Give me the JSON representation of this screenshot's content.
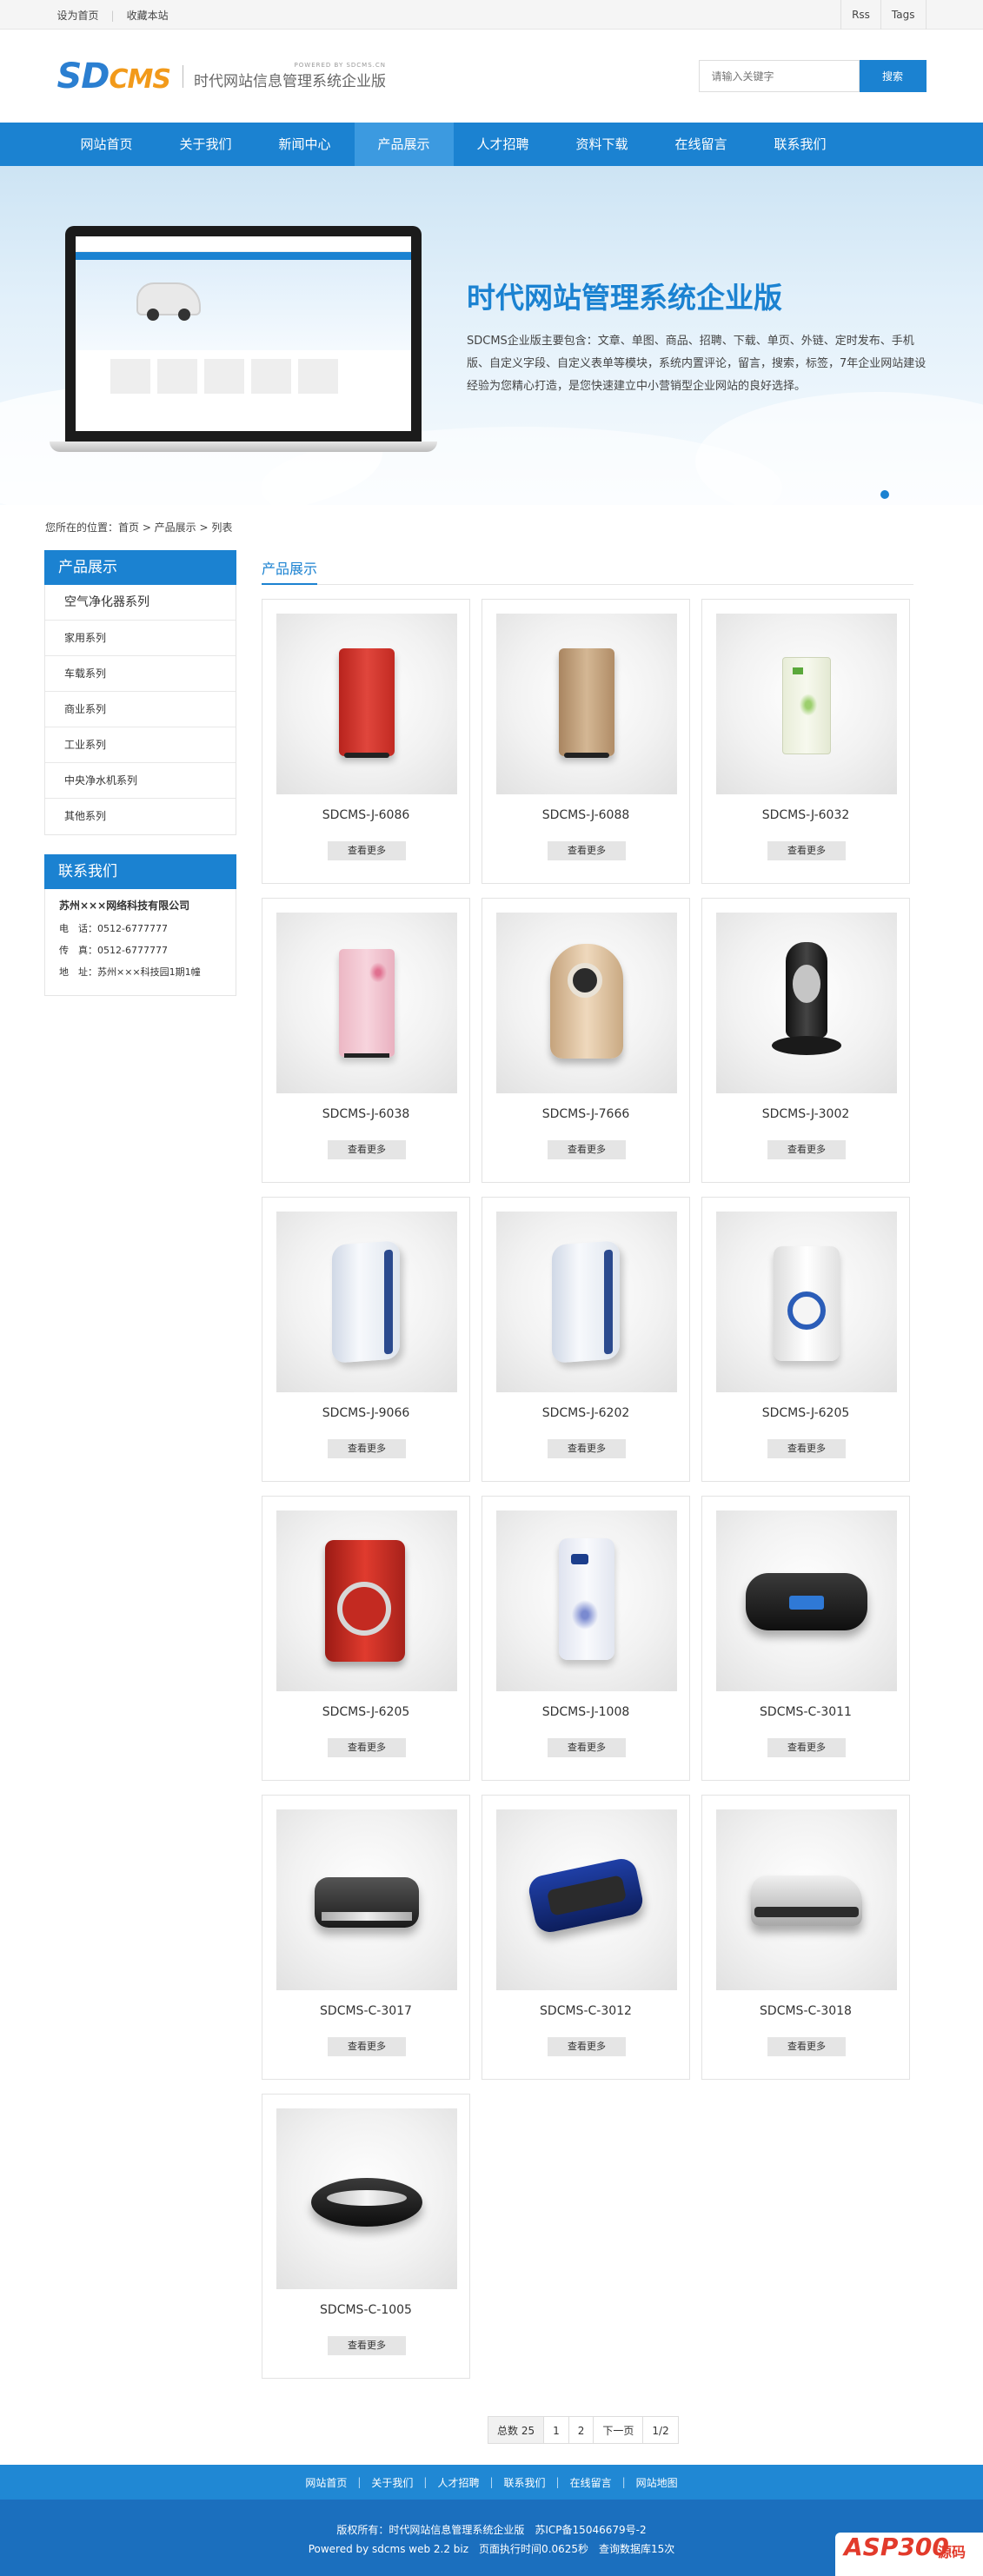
{
  "topbar": {
    "set_home": "设为首页",
    "bookmark": "收藏本站",
    "rss": "Rss",
    "tags": "Tags"
  },
  "header": {
    "logo_sd": "SD",
    "logo_cms": "CMS",
    "tagline": "时代网站信息管理系统企业版",
    "tagline_en": "POWERED BY SDCMS.CN",
    "search_placeholder": "请输入关键字",
    "search_button": "搜索"
  },
  "nav": [
    "网站首页",
    "关于我们",
    "新闻中心",
    "产品展示",
    "人才招聘",
    "资料下载",
    "在线留言",
    "联系我们"
  ],
  "nav_active_index": 3,
  "banner": {
    "title": "时代网站管理系统企业版",
    "desc": "SDCMS企业版主要包含：文章、单图、商品、招聘、下载、单页、外链、定时发布、手机版、自定义字段、自定义表单等模块，系统内置评论，留言，搜索，标签，7年企业网站建设经验为您精心打造，是您快速建立中小营销型企业网站的良好选择。"
  },
  "breadcrumb": "您所在的位置：首页 > 产品展示 > 列表",
  "sidebar": {
    "title": "产品展示",
    "items": [
      "空气净化器系列",
      "家用系列",
      "车载系列",
      "商业系列",
      "工业系列",
      "中央净水机系列",
      "其他系列"
    ],
    "contact_title": "联系我们",
    "company": "苏州×××网络科技有限公司",
    "phone": "电　话：0512-6777777",
    "fax": "传　真：0512-6777777",
    "address": "地　址：苏州×××科技园1期1幢"
  },
  "main": {
    "title": "产品展示",
    "more_label": "查看更多",
    "products": [
      {
        "name": "SDCMS-J-6086",
        "type": "tower-red"
      },
      {
        "name": "SDCMS-J-6088",
        "type": "tower-gold"
      },
      {
        "name": "SDCMS-J-6032",
        "type": "tower-green"
      },
      {
        "name": "SDCMS-J-6038",
        "type": "tower-pink"
      },
      {
        "name": "SDCMS-J-7666",
        "type": "round-beige"
      },
      {
        "name": "SDCMS-J-3002",
        "type": "tower-black"
      },
      {
        "name": "SDCMS-J-9066",
        "type": "tilted-white"
      },
      {
        "name": "SDCMS-J-6202",
        "type": "tilted-white"
      },
      {
        "name": "SDCMS-J-6205",
        "type": "white-blue-ring"
      },
      {
        "name": "SDCMS-J-6205",
        "type": "red-ring"
      },
      {
        "name": "SDCMS-J-1008",
        "type": "white-floral"
      },
      {
        "name": "SDCMS-C-3011",
        "type": "car-black"
      },
      {
        "name": "SDCMS-C-3017",
        "type": "car-dark"
      },
      {
        "name": "SDCMS-C-3012",
        "type": "car-blue"
      },
      {
        "name": "SDCMS-C-3018",
        "type": "car-silver"
      },
      {
        "name": "SDCMS-C-1005",
        "type": "car-oval"
      }
    ]
  },
  "pagination": {
    "total": "总数 25",
    "page1": "1",
    "page2": "2",
    "next": "下一页",
    "pages": "1/2"
  },
  "footer": {
    "links": [
      "网站首页",
      "关于我们",
      "人才招聘",
      "联系我们",
      "在线留言",
      "网站地图"
    ],
    "copyright": "版权所有：时代网站信息管理系统企业版　苏ICP备15046679号-2",
    "powered": "Powered by sdcms web 2.2 biz　页面执行时间0.0625秒　查询数据库15次",
    "badge_asp": "ASP300",
    "badge_src": "源码"
  }
}
